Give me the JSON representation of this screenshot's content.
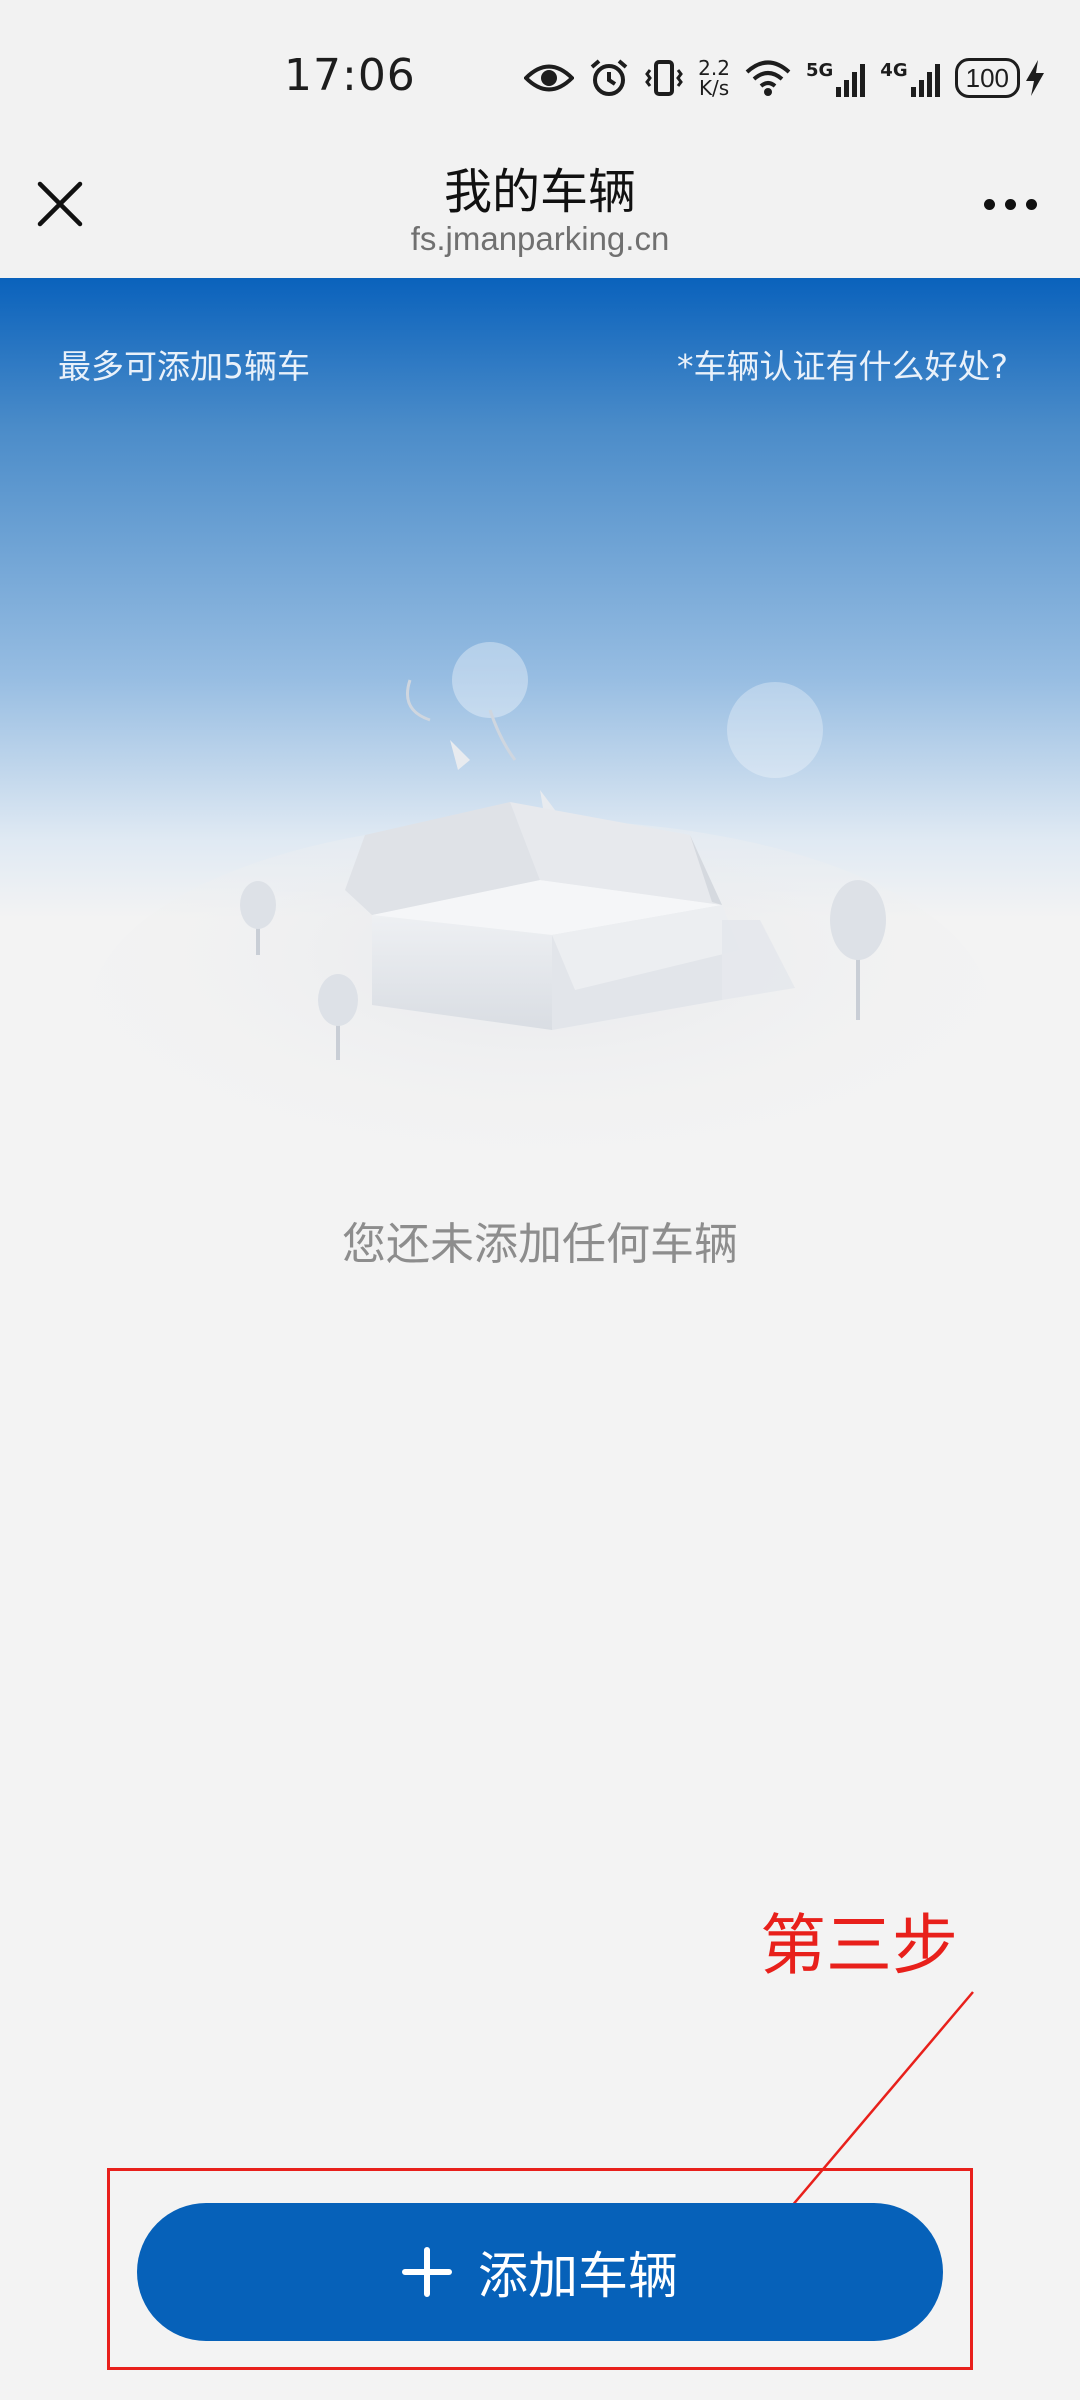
{
  "status_bar": {
    "time": "17:06",
    "net_speed_value": "2.2",
    "net_speed_unit": "K/s",
    "signal_1": "5G",
    "signal_2": "4G",
    "battery": "100"
  },
  "navbar": {
    "title": "我的车辆",
    "domain": "fs.jmanparking.cn"
  },
  "header_hints": {
    "left": "最多可添加5辆车",
    "right": "*车辆认证有什么好处?"
  },
  "empty_state": {
    "message": "您还未添加任何车辆"
  },
  "annotation": {
    "label": "第三步",
    "color": "#e8201b"
  },
  "primary_action": {
    "label": "添加车辆",
    "color": "#0661b9"
  },
  "icons": [
    "eye-icon",
    "alarm-icon",
    "vibrate-icon",
    "wifi-icon",
    "signal-icon",
    "battery-icon",
    "charging-icon",
    "close-icon",
    "more-icon",
    "plus-icon"
  ]
}
